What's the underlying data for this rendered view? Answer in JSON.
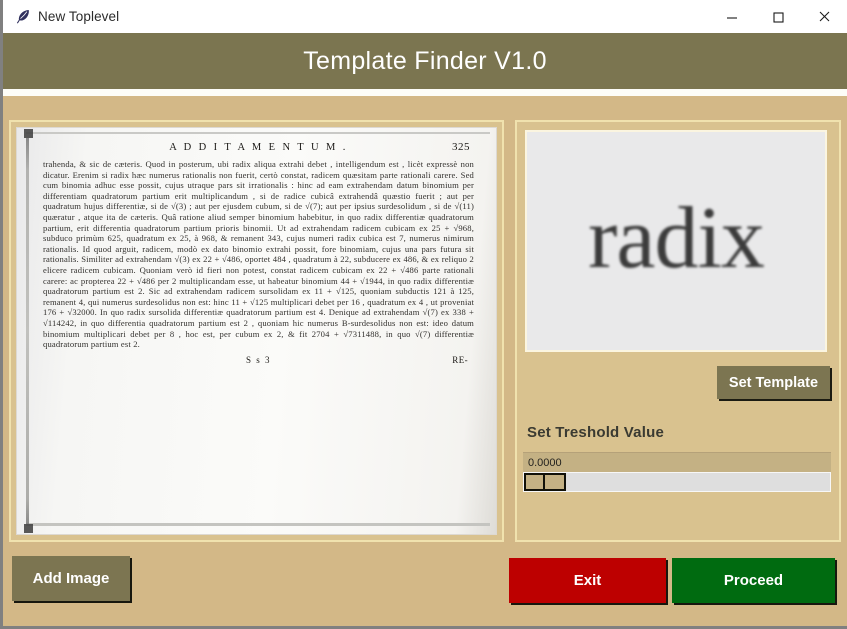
{
  "window": {
    "icon": "feather-icon",
    "title": "New Toplevel",
    "controls": {
      "minimize": "minimize-icon",
      "maximize": "maximize-icon",
      "close": "close-icon"
    }
  },
  "header": {
    "title": "Template Finder V1.0"
  },
  "left_panel": {
    "name": "source-image-panel",
    "document": {
      "running_head": "A D D I T A M E N T U M .",
      "folio": "325",
      "body": "trahenda, & sic de cæteris.  Quod in posterum, ubi radix aliqua extrahi debet , intelligendum est , licèt expressè non dicatur. Erenim si radix hæc numerus rationalis non fuerit, certò constat, radicem quæsitam parte rationali carere.  Sed cum binomia adhuc esse possit, cujus utraque pars sit irrationalis : hinc ad eam extrahendam datum binomium per differentiam quadratorum partium erit multiplicandum , si de radice cubicâ extrahendâ quæstio fuerit ; aut per quadratum hujus differentiæ, si de √(3) ; aut per ejusdem cubum, si de √(7); aut per ipsius surdesolidum , si de √(11) quæratur , atque ita de cæteris. Quâ ratione aliud semper binomium habebitur, in quo radix differentiæ quadratorum partium, erit differentia quadratorum partium prioris binomii.  Ut ad extrahendam radicem cubicam ex 25 + √968, subduco primùm 625, quadratum ex 25, à 968, & remanent 343, cujus numeri radix cubica est 7, numerus nimirum rationalis.  Id quod arguit, radicem, modò ex dato binomio extrahi possit, fore binomiam, cujus una pars futura sit rationalis.  Similiter ad extrahendam √(3) ex 22 + √486, oportet 484 , quadratum à 22, subducere ex 486, & ex reliquo 2 elicere radicem cubicam.  Quoniam verò id fieri non potest, constat radicem cubicam ex 22 + √486 parte rationali carere: ac propterea 22 + √486 per 2 multiplicandam esse, ut habeatur binomium 44 + √1944, in quo radix differentiæ quadratorum partium est 2. Sic ad extrahendam radicem sursolidam ex 11 + √125, quoniam subductis 121 à 125, remanent 4, qui numerus surdesolidus non est: hinc 11 + √125 multiplicari debet per 16 , quadratum ex 4 , ut proveniat 176 + √32000. In quo radix sursolida differentiæ quadratorum partium est 4. Denique ad extrahendam √(7) ex 338 + √114242, in quo differentia quadratorum partium est 2 , quoniam hic numerus B-surdesolidus non est: ideo datum binomium multiplicari debet per 8 , hoc est, per cubum ex 2, & fit 2704 + √7311488, in quo √(7) differentiæ quadratorum partium est 2.",
      "signature": "S s 3",
      "catchword": "RE-"
    }
  },
  "right_panel": {
    "name": "template-panel",
    "template_preview_text": "radix",
    "set_template_label": "Set Template",
    "threshold_label": "Set Treshold Value",
    "threshold_value": "0.0000",
    "threshold_slider_position": 0
  },
  "footer": {
    "add_image_label": "Add Image",
    "exit_label": "Exit",
    "proceed_label": "Proceed"
  },
  "colors": {
    "header_olive": "#7b7550",
    "body_tan": "#d3b887",
    "panel_tan": "#d9c28f",
    "panel_border": "#f0e2ae",
    "button_olive": "#7c7551",
    "exit_red": "#bd0000",
    "proceed_green": "#006b10",
    "window_border_gray": "#808080"
  }
}
